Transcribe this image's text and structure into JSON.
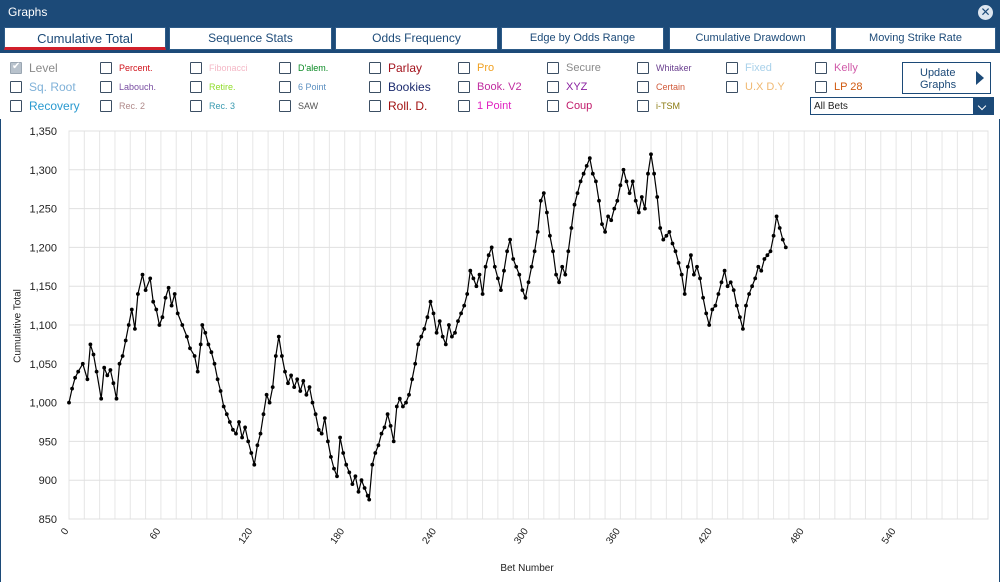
{
  "window": {
    "title": "Graphs"
  },
  "tabs": [
    {
      "label": "Cumulative Total",
      "active": true
    },
    {
      "label": "Sequence Stats",
      "active": false
    },
    {
      "label": "Odds Frequency",
      "active": false
    },
    {
      "label": "Edge by Odds Range",
      "active": false
    },
    {
      "label": "Cumulative Drawdown",
      "active": false
    },
    {
      "label": "Moving Strike Rate",
      "active": false
    }
  ],
  "strategies": [
    {
      "label": "Level",
      "color": "#8a8a8a",
      "checked": true
    },
    {
      "label": "Percent.",
      "color": "#d0121b",
      "checked": false
    },
    {
      "label": "Fibonacci",
      "color": "#f4b8c6",
      "checked": false
    },
    {
      "label": "D'alem.",
      "color": "#0b8a24",
      "checked": false
    },
    {
      "label": "Parlay",
      "color": "#a3141e",
      "checked": false
    },
    {
      "label": "Pro",
      "color": "#f0a020",
      "checked": false
    },
    {
      "label": "Secure",
      "color": "#8a8a8a",
      "checked": false
    },
    {
      "label": "Whitaker",
      "color": "#6a3f8f",
      "checked": false
    },
    {
      "label": "Fixed",
      "color": "#a9d1ea",
      "checked": false
    },
    {
      "label": "Kelly",
      "color": "#d05aa8",
      "checked": false
    },
    {
      "label": "Sq. Root",
      "color": "#7fb1d8",
      "checked": false
    },
    {
      "label": "Labouch.",
      "color": "#7a4fa2",
      "checked": false
    },
    {
      "label": "Retire.",
      "color": "#8fdc2a",
      "checked": false
    },
    {
      "label": "6 Point",
      "color": "#5a8fc0",
      "checked": false
    },
    {
      "label": "Bookies",
      "color": "#1c2b6e",
      "checked": false
    },
    {
      "label": "Book. V2",
      "color": "#c02da0",
      "checked": false
    },
    {
      "label": "XYZ",
      "color": "#8a1fa0",
      "checked": false
    },
    {
      "label": "Certain",
      "color": "#d05a3a",
      "checked": false
    },
    {
      "label": "U.X D.Y",
      "color": "#f0b870",
      "checked": false
    },
    {
      "label": "LP 28",
      "color": "#d05a10",
      "checked": false
    },
    {
      "label": "Recovery",
      "color": "#2a9ad0",
      "checked": false
    },
    {
      "label": "Rec. 2",
      "color": "#b08a8a",
      "checked": false
    },
    {
      "label": "Rec. 3",
      "color": "#3a9ab0",
      "checked": false
    },
    {
      "label": "SAW",
      "color": "#555555",
      "checked": false
    },
    {
      "label": "Roll. D.",
      "color": "#a01010",
      "checked": false
    },
    {
      "label": "1 Point",
      "color": "#e020c0",
      "checked": false
    },
    {
      "label": "Coup",
      "color": "#c01a6a",
      "checked": false
    },
    {
      "label": "i-TSM",
      "color": "#8a7a10",
      "checked": false
    }
  ],
  "update_button": {
    "line1": "Update",
    "line2": "Graphs"
  },
  "bet_filter": {
    "value": "All Bets"
  },
  "chart_data": {
    "type": "line",
    "xlabel": "Bet Number",
    "ylabel": "Cumulative Total",
    "xlim": [
      0,
      600
    ],
    "ylim": [
      850,
      1350
    ],
    "x_ticks": [
      "0",
      "60",
      "120",
      "180",
      "240",
      "300",
      "360",
      "420",
      "480",
      "540"
    ],
    "y_ticks": [
      "850",
      "900",
      "950",
      "1,000",
      "1,050",
      "1,100",
      "1,150",
      "1,200",
      "1,250",
      "1,300",
      "1,350"
    ],
    "grid": true,
    "color": "#000000",
    "keypoints": [
      [
        0,
        1000
      ],
      [
        2,
        1018
      ],
      [
        4,
        1032
      ],
      [
        6,
        1040
      ],
      [
        9,
        1050
      ],
      [
        12,
        1030
      ],
      [
        14,
        1075
      ],
      [
        16,
        1062
      ],
      [
        18,
        1040
      ],
      [
        21,
        1005
      ],
      [
        23,
        1045
      ],
      [
        25,
        1035
      ],
      [
        27,
        1042
      ],
      [
        29,
        1025
      ],
      [
        31,
        1005
      ],
      [
        33,
        1050
      ],
      [
        35,
        1060
      ],
      [
        37,
        1080
      ],
      [
        39,
        1100
      ],
      [
        41,
        1120
      ],
      [
        43,
        1095
      ],
      [
        45,
        1140
      ],
      [
        48,
        1165
      ],
      [
        50,
        1145
      ],
      [
        53,
        1160
      ],
      [
        55,
        1130
      ],
      [
        57,
        1120
      ],
      [
        59,
        1100
      ],
      [
        61,
        1110
      ],
      [
        63,
        1135
      ],
      [
        65,
        1148
      ],
      [
        67,
        1125
      ],
      [
        69,
        1140
      ],
      [
        71,
        1115
      ],
      [
        74,
        1100
      ],
      [
        77,
        1085
      ],
      [
        79,
        1070
      ],
      [
        82,
        1060
      ],
      [
        84,
        1040
      ],
      [
        86,
        1075
      ],
      [
        87,
        1100
      ],
      [
        89,
        1090
      ],
      [
        91,
        1075
      ],
      [
        93,
        1065
      ],
      [
        95,
        1050
      ],
      [
        97,
        1030
      ],
      [
        99,
        1015
      ],
      [
        101,
        995
      ],
      [
        103,
        985
      ],
      [
        105,
        975
      ],
      [
        107,
        965
      ],
      [
        109,
        960
      ],
      [
        111,
        975
      ],
      [
        113,
        955
      ],
      [
        115,
        968
      ],
      [
        117,
        950
      ],
      [
        119,
        935
      ],
      [
        121,
        920
      ],
      [
        123,
        945
      ],
      [
        125,
        960
      ],
      [
        127,
        985
      ],
      [
        129,
        1010
      ],
      [
        131,
        1000
      ],
      [
        133,
        1020
      ],
      [
        135,
        1060
      ],
      [
        137,
        1085
      ],
      [
        139,
        1060
      ],
      [
        141,
        1040
      ],
      [
        143,
        1025
      ],
      [
        145,
        1035
      ],
      [
        147,
        1020
      ],
      [
        149,
        1030
      ],
      [
        151,
        1015
      ],
      [
        153,
        1028
      ],
      [
        155,
        1010
      ],
      [
        157,
        1020
      ],
      [
        159,
        1000
      ],
      [
        161,
        985
      ],
      [
        163,
        965
      ],
      [
        165,
        960
      ],
      [
        167,
        980
      ],
      [
        169,
        950
      ],
      [
        171,
        930
      ],
      [
        173,
        915
      ],
      [
        175,
        905
      ],
      [
        177,
        955
      ],
      [
        179,
        935
      ],
      [
        181,
        920
      ],
      [
        183,
        910
      ],
      [
        185,
        895
      ],
      [
        187,
        905
      ],
      [
        189,
        885
      ],
      [
        191,
        900
      ],
      [
        193,
        890
      ],
      [
        195,
        880
      ],
      [
        196,
        875
      ],
      [
        198,
        920
      ],
      [
        200,
        935
      ],
      [
        202,
        945
      ],
      [
        204,
        960
      ],
      [
        206,
        968
      ],
      [
        208,
        985
      ],
      [
        210,
        970
      ],
      [
        212,
        950
      ],
      [
        214,
        995
      ],
      [
        216,
        1005
      ],
      [
        218,
        995
      ],
      [
        220,
        1000
      ],
      [
        222,
        1010
      ],
      [
        224,
        1030
      ],
      [
        226,
        1050
      ],
      [
        228,
        1075
      ],
      [
        230,
        1085
      ],
      [
        232,
        1095
      ],
      [
        234,
        1110
      ],
      [
        236,
        1130
      ],
      [
        238,
        1115
      ],
      [
        240,
        1090
      ],
      [
        242,
        1105
      ],
      [
        244,
        1085
      ],
      [
        246,
        1075
      ],
      [
        248,
        1100
      ],
      [
        250,
        1085
      ],
      [
        252,
        1090
      ],
      [
        254,
        1105
      ],
      [
        256,
        1115
      ],
      [
        258,
        1125
      ],
      [
        260,
        1140
      ],
      [
        262,
        1170
      ],
      [
        264,
        1160
      ],
      [
        266,
        1150
      ],
      [
        268,
        1165
      ],
      [
        270,
        1140
      ],
      [
        272,
        1175
      ],
      [
        274,
        1190
      ],
      [
        276,
        1200
      ],
      [
        278,
        1175
      ],
      [
        280,
        1160
      ],
      [
        282,
        1145
      ],
      [
        284,
        1170
      ],
      [
        286,
        1195
      ],
      [
        288,
        1210
      ],
      [
        290,
        1185
      ],
      [
        292,
        1175
      ],
      [
        294,
        1165
      ],
      [
        296,
        1145
      ],
      [
        298,
        1135
      ],
      [
        300,
        1155
      ],
      [
        302,
        1175
      ],
      [
        304,
        1195
      ],
      [
        306,
        1220
      ],
      [
        308,
        1260
      ],
      [
        310,
        1270
      ],
      [
        312,
        1245
      ],
      [
        314,
        1215
      ],
      [
        316,
        1195
      ],
      [
        318,
        1165
      ],
      [
        320,
        1155
      ],
      [
        322,
        1175
      ],
      [
        324,
        1165
      ],
      [
        326,
        1195
      ],
      [
        328,
        1225
      ],
      [
        330,
        1255
      ],
      [
        332,
        1270
      ],
      [
        334,
        1285
      ],
      [
        336,
        1295
      ],
      [
        338,
        1305
      ],
      [
        340,
        1315
      ],
      [
        342,
        1295
      ],
      [
        344,
        1285
      ],
      [
        346,
        1260
      ],
      [
        348,
        1230
      ],
      [
        350,
        1220
      ],
      [
        352,
        1240
      ],
      [
        354,
        1235
      ],
      [
        356,
        1250
      ],
      [
        358,
        1260
      ],
      [
        360,
        1280
      ],
      [
        362,
        1300
      ],
      [
        364,
        1285
      ],
      [
        366,
        1270
      ],
      [
        368,
        1285
      ],
      [
        370,
        1260
      ],
      [
        372,
        1245
      ],
      [
        374,
        1265
      ],
      [
        376,
        1250
      ],
      [
        378,
        1295
      ],
      [
        380,
        1320
      ],
      [
        382,
        1295
      ],
      [
        384,
        1265
      ],
      [
        386,
        1225
      ],
      [
        388,
        1210
      ],
      [
        390,
        1215
      ],
      [
        392,
        1220
      ],
      [
        394,
        1205
      ],
      [
        396,
        1195
      ],
      [
        398,
        1180
      ],
      [
        400,
        1165
      ],
      [
        402,
        1140
      ],
      [
        404,
        1175
      ],
      [
        406,
        1190
      ],
      [
        408,
        1165
      ],
      [
        410,
        1175
      ],
      [
        412,
        1160
      ],
      [
        414,
        1135
      ],
      [
        416,
        1115
      ],
      [
        418,
        1100
      ],
      [
        420,
        1120
      ],
      [
        422,
        1125
      ],
      [
        424,
        1140
      ],
      [
        426,
        1155
      ],
      [
        428,
        1170
      ],
      [
        430,
        1150
      ],
      [
        432,
        1155
      ],
      [
        434,
        1145
      ],
      [
        436,
        1125
      ],
      [
        438,
        1110
      ],
      [
        440,
        1095
      ],
      [
        442,
        1125
      ],
      [
        444,
        1140
      ],
      [
        446,
        1150
      ],
      [
        448,
        1160
      ],
      [
        450,
        1175
      ],
      [
        452,
        1170
      ],
      [
        454,
        1185
      ],
      [
        456,
        1190
      ],
      [
        458,
        1195
      ],
      [
        460,
        1215
      ],
      [
        462,
        1240
      ],
      [
        464,
        1225
      ],
      [
        466,
        1210
      ],
      [
        468,
        1200
      ]
    ]
  }
}
